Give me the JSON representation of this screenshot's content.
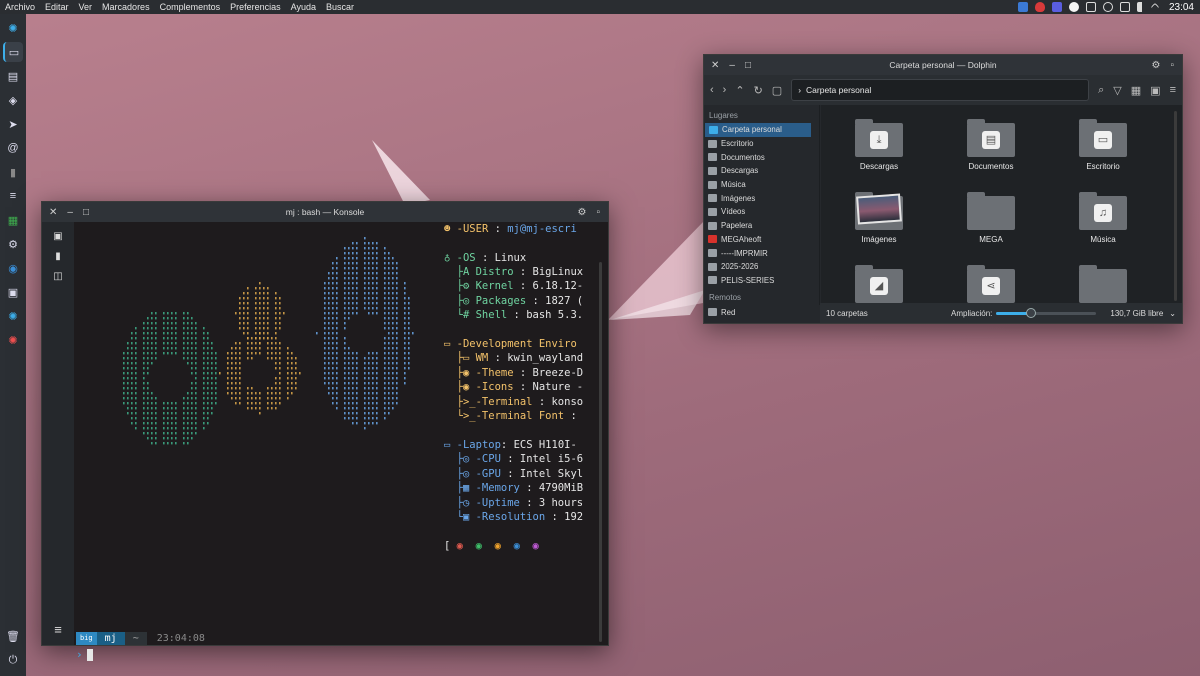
{
  "menubar": {
    "items": [
      "Archivo",
      "Editar",
      "Ver",
      "Marcadores",
      "Complementos",
      "Preferencias",
      "Ayuda",
      "Buscar"
    ],
    "clock": "23:04",
    "tray_icons": [
      "network-icon",
      "shield-icon",
      "calendar-icon",
      "mega-icon",
      "clipboard-icon",
      "brightness-icon",
      "power-icon",
      "volume-icon",
      "expand-icon"
    ]
  },
  "dock": {
    "icons": [
      "biglinux-logo-icon",
      "terminal-icon",
      "file-manager-icon",
      "shield-icon",
      "telegram-icon",
      "email-icon",
      "document-icon",
      "notes-icon",
      "spreadsheet-icon",
      "settings-icon",
      "steam-icon",
      "screenshot-icon",
      "biglinux-icon",
      "biglinux-update-icon",
      "trash-icon",
      "power-icon"
    ]
  },
  "konsole": {
    "title": "mj : bash — Konsole",
    "info": {
      "user_label": "-USER",
      "user_value": "mj@mj-escri",
      "os_label": "-OS",
      "os_value": "Linux",
      "distro_label": "Distro",
      "distro_value": "BigLinux",
      "kernel_label": "Kernel",
      "kernel_value": "6.18.12-",
      "packages_label": "Packages",
      "packages_value": "1827 (",
      "shell_label": "Shell",
      "shell_value": "bash 5.3.",
      "dev_label": "-Development Enviro",
      "wm_label": "WM",
      "wm_value": "kwin_wayland",
      "theme_label": "-Theme",
      "theme_value": "Breeze-D",
      "icons_label": "-Icons",
      "icons_value": "Nature -",
      "terminal_label": "-Terminal",
      "terminal_value": "konso",
      "termfont_label": "-Terminal Font",
      "termfont_value": "",
      "laptop_label": "-Laptop",
      "laptop_value": "ECS H110I-",
      "cpu_label": "-CPU",
      "cpu_value": "Intel i5-6",
      "gpu_label": "-GPU",
      "gpu_value": "Intel Skyl",
      "memory_label": "-Memory",
      "memory_value": "4790MiB",
      "uptime_label": "-Uptime",
      "uptime_value": "3 hours",
      "resolution_label": "-Resolution",
      "resolution_value": "192"
    },
    "palette": [
      "#e05a4f",
      "#3fc06a",
      "#f0a32c",
      "#3b8fd8",
      "#c05ad6"
    ],
    "prompt": {
      "logo": "big",
      "user": "mj",
      "dir": "~",
      "time": "23:04:08",
      "prompt_symbol": "›"
    }
  },
  "dolphin": {
    "title": "Carpeta personal — Dolphin",
    "breadcrumb": "Carpeta personal",
    "places_header": "Lugares",
    "places": [
      {
        "label": "Carpeta personal",
        "color": "#3daee9",
        "selected": true
      },
      {
        "label": "Escritorio",
        "color": "#9aa0a6"
      },
      {
        "label": "Documentos",
        "color": "#9aa0a6"
      },
      {
        "label": "Descargas",
        "color": "#9aa0a6"
      },
      {
        "label": "Música",
        "color": "#9aa0a6"
      },
      {
        "label": "Imágenes",
        "color": "#9aa0a6"
      },
      {
        "label": "Vídeos",
        "color": "#9aa0a6"
      },
      {
        "label": "Papelera",
        "color": "#9aa0a6"
      },
      {
        "label": "MEGAheoft",
        "color": "#d8322c"
      },
      {
        "label": "-----IMPRMIR",
        "color": "#9aa0a6"
      },
      {
        "label": "2025-2026",
        "color": "#9aa0a6"
      },
      {
        "label": "PELIS-SERIES",
        "color": "#9aa0a6"
      }
    ],
    "remote_header": "Remotos",
    "remote_items": [
      {
        "label": "Red",
        "color": "#9aa0a6"
      }
    ],
    "folders": [
      {
        "label": "Descargas",
        "emblem": "⤓"
      },
      {
        "label": "Documentos",
        "emblem": "▤"
      },
      {
        "label": "Escritorio",
        "emblem": "▭"
      },
      {
        "label": "Imágenes",
        "emblem": "photo"
      },
      {
        "label": "MEGA",
        "emblem": ""
      },
      {
        "label": "Música",
        "emblem": "♫"
      },
      {
        "label": "",
        "emblem": "◢"
      },
      {
        "label": "",
        "emblem": "⋖"
      },
      {
        "label": "",
        "emblem": ""
      }
    ],
    "status": {
      "count": "10 carpetas",
      "zoom_label": "Ampliación:",
      "zoom_fraction": 0.35,
      "free_space": "130,7 GiB libre"
    }
  }
}
